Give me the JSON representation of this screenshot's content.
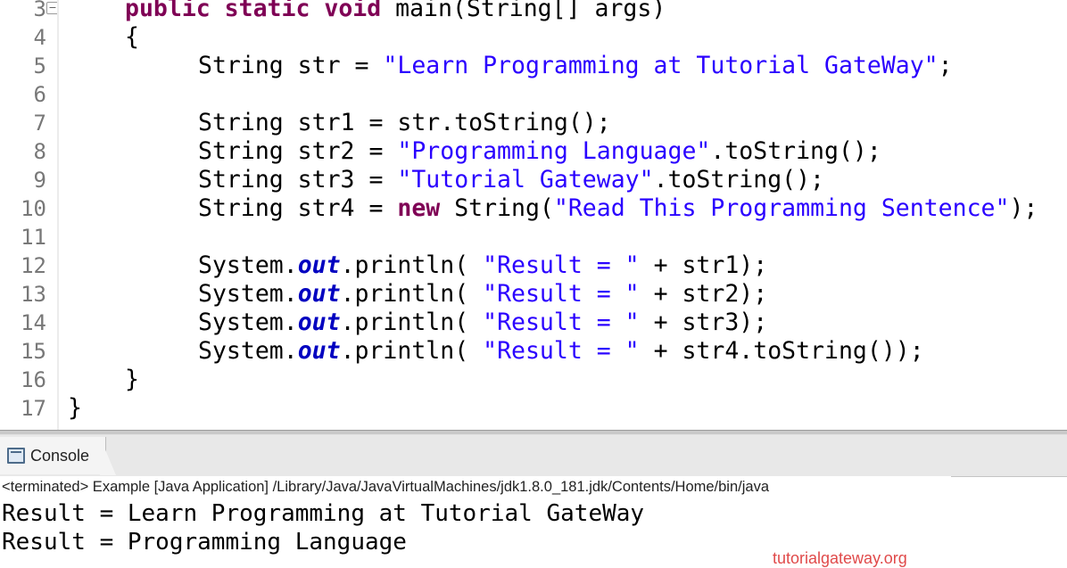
{
  "editor": {
    "line_numbers": [
      "3",
      "4",
      "5",
      "6",
      "7",
      "8",
      "9",
      "10",
      "11",
      "12",
      "13",
      "14",
      "15",
      "16",
      "17"
    ],
    "lines": {
      "l3": {
        "kw1": "public static void ",
        "rest": "main(String[] args)"
      },
      "l4": {
        "text": "{"
      },
      "l5": {
        "pre": "String str = ",
        "s": "\"Learn Programming at Tutorial GateWay\"",
        "post": ";"
      },
      "l7": {
        "text": "String str1 = str.toString();"
      },
      "l8": {
        "pre": "String str2 = ",
        "s": "\"Programming Language\"",
        "post": ".toString();"
      },
      "l9": {
        "pre": "String str3 = ",
        "s": "\"Tutorial Gateway\"",
        "post": ".toString();"
      },
      "l10": {
        "pre": "String str4 = ",
        "kw": "new",
        "mid": " String(",
        "s": "\"Read This Programming Sentence\"",
        "post": ");"
      },
      "l12": {
        "pre": "System.",
        "fld": "out",
        "mid": ".println( ",
        "s": "\"Result = \"",
        "post": " + str1);"
      },
      "l13": {
        "pre": "System.",
        "fld": "out",
        "mid": ".println( ",
        "s": "\"Result = \"",
        "post": " + str2);"
      },
      "l14": {
        "pre": "System.",
        "fld": "out",
        "mid": ".println( ",
        "s": "\"Result = \"",
        "post": " + str3);"
      },
      "l15": {
        "pre": "System.",
        "fld": "out",
        "mid": ".println( ",
        "s": "\"Result = \"",
        "post": " + str4.toString());"
      },
      "l16": {
        "text": "}"
      },
      "l17": {
        "text": "}"
      }
    },
    "fold_marker": "−"
  },
  "console": {
    "tab_label": "Console",
    "tab_icon": "console-icon",
    "description": "<terminated> Example [Java Application] /Library/Java/JavaVirtualMachines/jdk1.8.0_181.jdk/Contents/Home/bin/java",
    "output": [
      "Result = Learn Programming at Tutorial GateWay",
      "Result = Programming Language"
    ]
  },
  "watermark": "tutorialgateway.org",
  "colors": {
    "keyword": "#7f0055",
    "string": "#2a00ff",
    "static_field": "#0000c0",
    "line_number": "#787878"
  }
}
